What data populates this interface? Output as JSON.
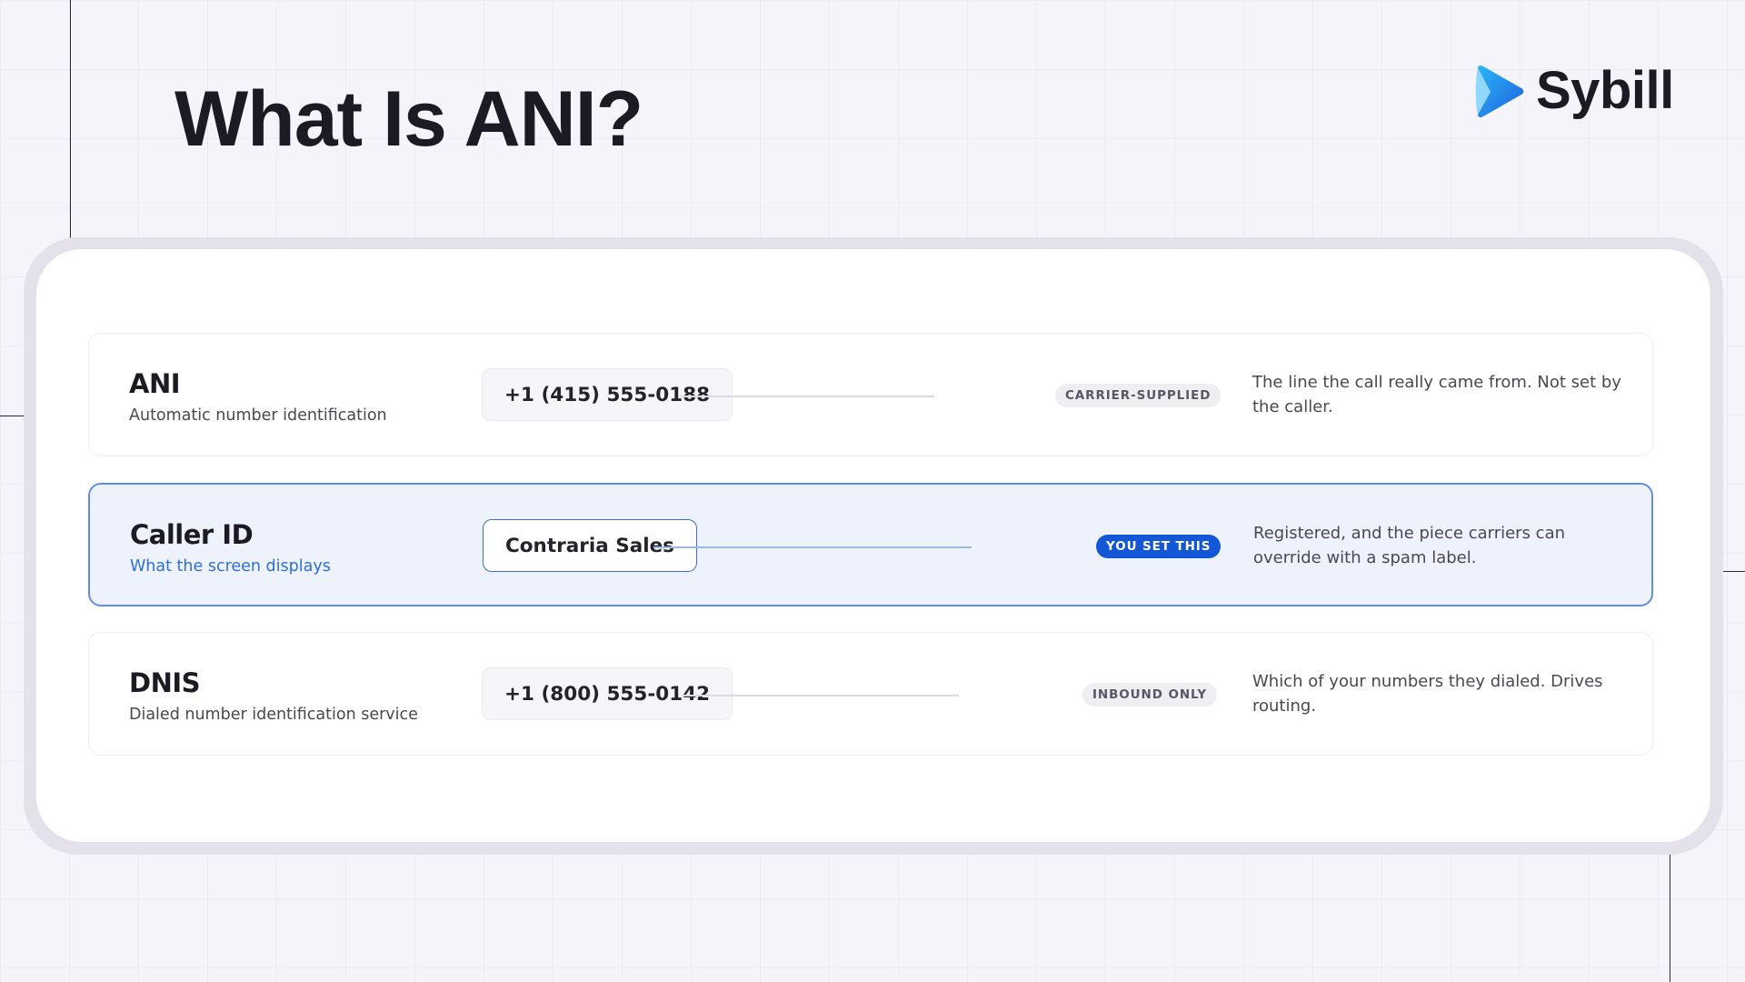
{
  "slide": {
    "title": "What Is ANI?"
  },
  "brand": {
    "name": "Sybill",
    "icon": "sybill-play-logo",
    "colors": {
      "gradient_start": "#2bb7f5",
      "gradient_end": "#1e5fe0"
    }
  },
  "rows": [
    {
      "term": "ANI",
      "subtitle": "Automatic number identification",
      "value": "+1 (415) 555-0188",
      "badge": "CARRIER-SUPPLIED",
      "description": "The line the call really came from. Not set by the caller.",
      "highlighted": false
    },
    {
      "term": "Caller ID",
      "subtitle": "What the screen displays",
      "value": "Contraria Sales",
      "badge": "YOU SET THIS",
      "description": "Registered, and the piece carriers can override with a spam label.",
      "highlighted": true
    },
    {
      "term": "DNIS",
      "subtitle": "Dialed number identification service",
      "value": "+1 (800) 555-0142",
      "badge": "INBOUND ONLY",
      "description": "Which of your numbers they dialed. Drives routing.",
      "highlighted": false
    }
  ],
  "colors": {
    "accent": "#1457d6",
    "highlight_bg": "#eef2fd",
    "highlight_border": "#5f8fe6",
    "title": "#1c1a22"
  }
}
